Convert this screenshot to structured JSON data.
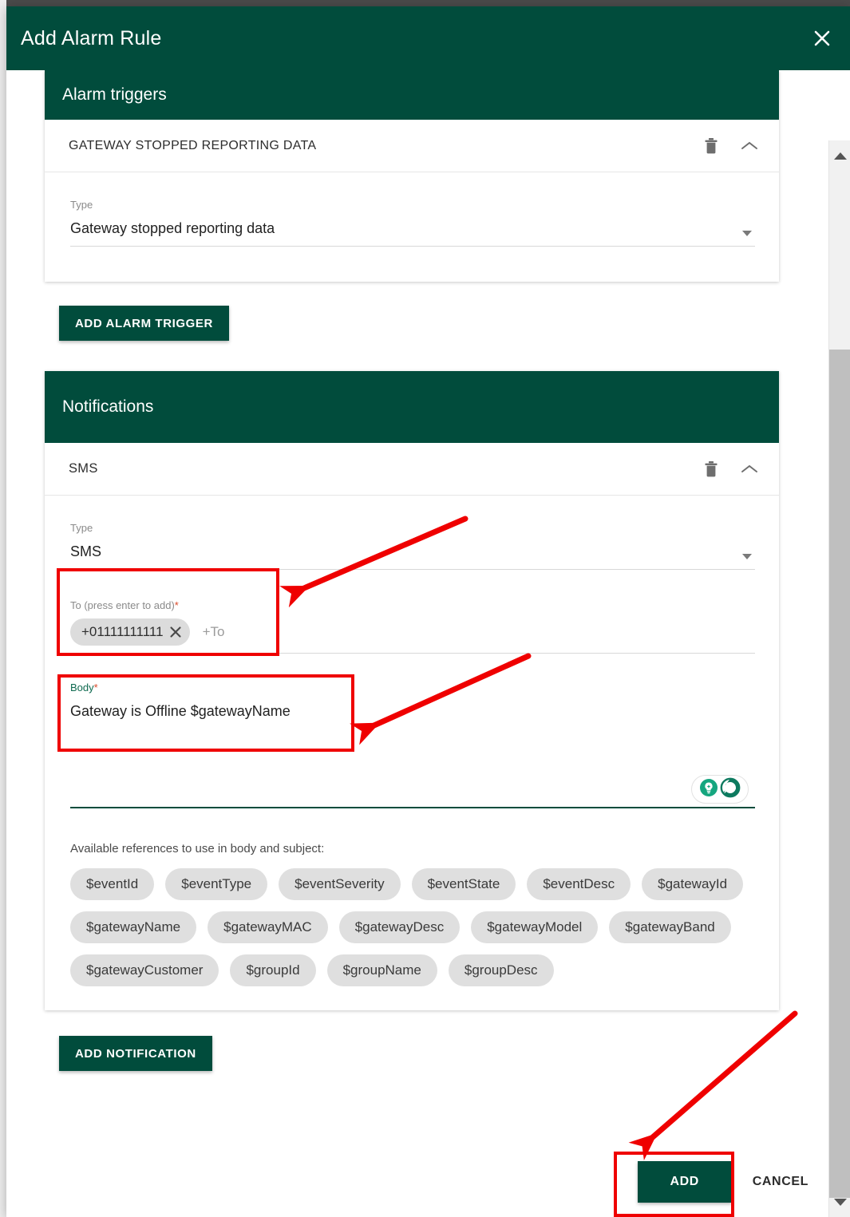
{
  "dialog": {
    "title": "Add Alarm Rule",
    "close_icon": "close-icon"
  },
  "alarm_triggers": {
    "section_title": "Alarm triggers",
    "trigger": {
      "header": "GATEWAY STOPPED REPORTING DATA",
      "delete_icon": "trash-icon",
      "collapse_icon": "chevron-up-icon",
      "type_label": "Type",
      "type_value": "Gateway stopped reporting data"
    },
    "add_button": "ADD ALARM TRIGGER"
  },
  "notifications": {
    "section_title": "Notifications",
    "item": {
      "header": "SMS",
      "delete_icon": "trash-icon",
      "collapse_icon": "chevron-up-icon",
      "type_label": "Type",
      "type_value": "SMS",
      "to_label": "To (press enter to add)",
      "to_required": "*",
      "to_chip": "+01111111111",
      "to_chip_remove_icon": "chip-close-icon",
      "to_placeholder": "+To",
      "body_label": "Body",
      "body_required": "*",
      "body_value": "Gateway is Offline $gatewayName",
      "grammarly_icons": [
        "lightbulb-icon",
        "grammarly-logo-icon"
      ]
    },
    "references_label": "Available references to use in body and subject:",
    "references": [
      [
        "$eventId",
        "$eventType",
        "$eventSeverity",
        "$eventState",
        "$eventDesc",
        "$gatewayId"
      ],
      [
        "$gatewayName",
        "$gatewayMAC",
        "$gatewayDesc",
        "$gatewayModel",
        "$gatewayBand"
      ],
      [
        "$gatewayCustomer",
        "$groupId",
        "$groupName",
        "$groupDesc"
      ]
    ],
    "add_button": "ADD NOTIFICATION"
  },
  "footer": {
    "add_label": "ADD",
    "cancel_label": "CANCEL"
  },
  "scrollbar": {
    "up_icon": "scroll-up-arrow-icon",
    "down_icon": "scroll-down-arrow-icon"
  },
  "colors": {
    "brand_green": "#014c3c",
    "annotation_red": "#ef0000",
    "chip_gray": "#dfdfdf",
    "required_asterisk": "#d94a2b"
  }
}
